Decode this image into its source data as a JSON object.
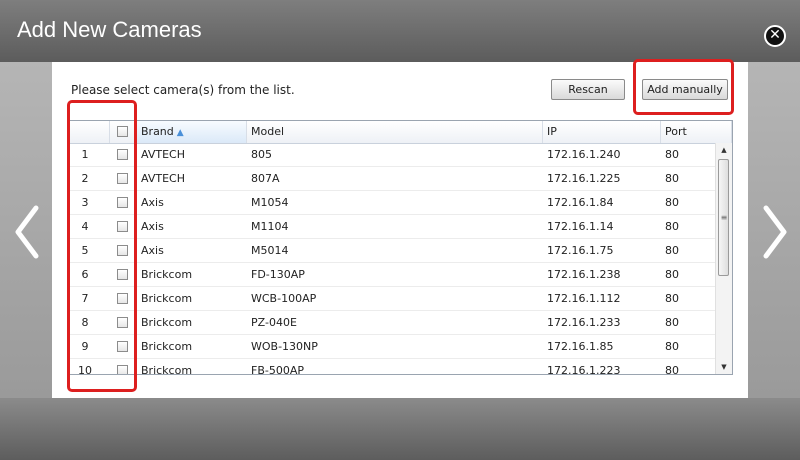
{
  "window": {
    "title": "Add New Cameras",
    "close_icon": "close-icon"
  },
  "content": {
    "instruction": "Please select camera(s) from the list.",
    "rescan_label": "Rescan",
    "add_manually_label": "Add manually"
  },
  "table": {
    "headers": {
      "brand": "Brand",
      "model": "Model",
      "ip": "IP",
      "port": "Port"
    },
    "sort": {
      "column": "Brand",
      "direction": "ascending"
    },
    "rows": [
      {
        "num": "1",
        "brand": "AVTECH",
        "model": "805",
        "ip": "172.16.1.240",
        "port": "80"
      },
      {
        "num": "2",
        "brand": "AVTECH",
        "model": "807A",
        "ip": "172.16.1.225",
        "port": "80"
      },
      {
        "num": "3",
        "brand": "Axis",
        "model": "M1054",
        "ip": "172.16.1.84",
        "port": "80"
      },
      {
        "num": "4",
        "brand": "Axis",
        "model": "M1104",
        "ip": "172.16.1.14",
        "port": "80"
      },
      {
        "num": "5",
        "brand": "Axis",
        "model": "M5014",
        "ip": "172.16.1.75",
        "port": "80"
      },
      {
        "num": "6",
        "brand": "Brickcom",
        "model": "FD-130AP",
        "ip": "172.16.1.238",
        "port": "80"
      },
      {
        "num": "7",
        "brand": "Brickcom",
        "model": "WCB-100AP",
        "ip": "172.16.1.112",
        "port": "80"
      },
      {
        "num": "8",
        "brand": "Brickcom",
        "model": "PZ-040E",
        "ip": "172.16.1.233",
        "port": "80"
      },
      {
        "num": "9",
        "brand": "Brickcom",
        "model": "WOB-130NP",
        "ip": "172.16.1.85",
        "port": "80"
      },
      {
        "num": "10",
        "brand": "Brickcom",
        "model": "FB-500AP",
        "ip": "172.16.1.223",
        "port": "80"
      }
    ]
  },
  "colors": {
    "highlight": "#dd1f1f",
    "title_bar": "#6e6e6e",
    "sort_arrow": "#4a90d9"
  }
}
